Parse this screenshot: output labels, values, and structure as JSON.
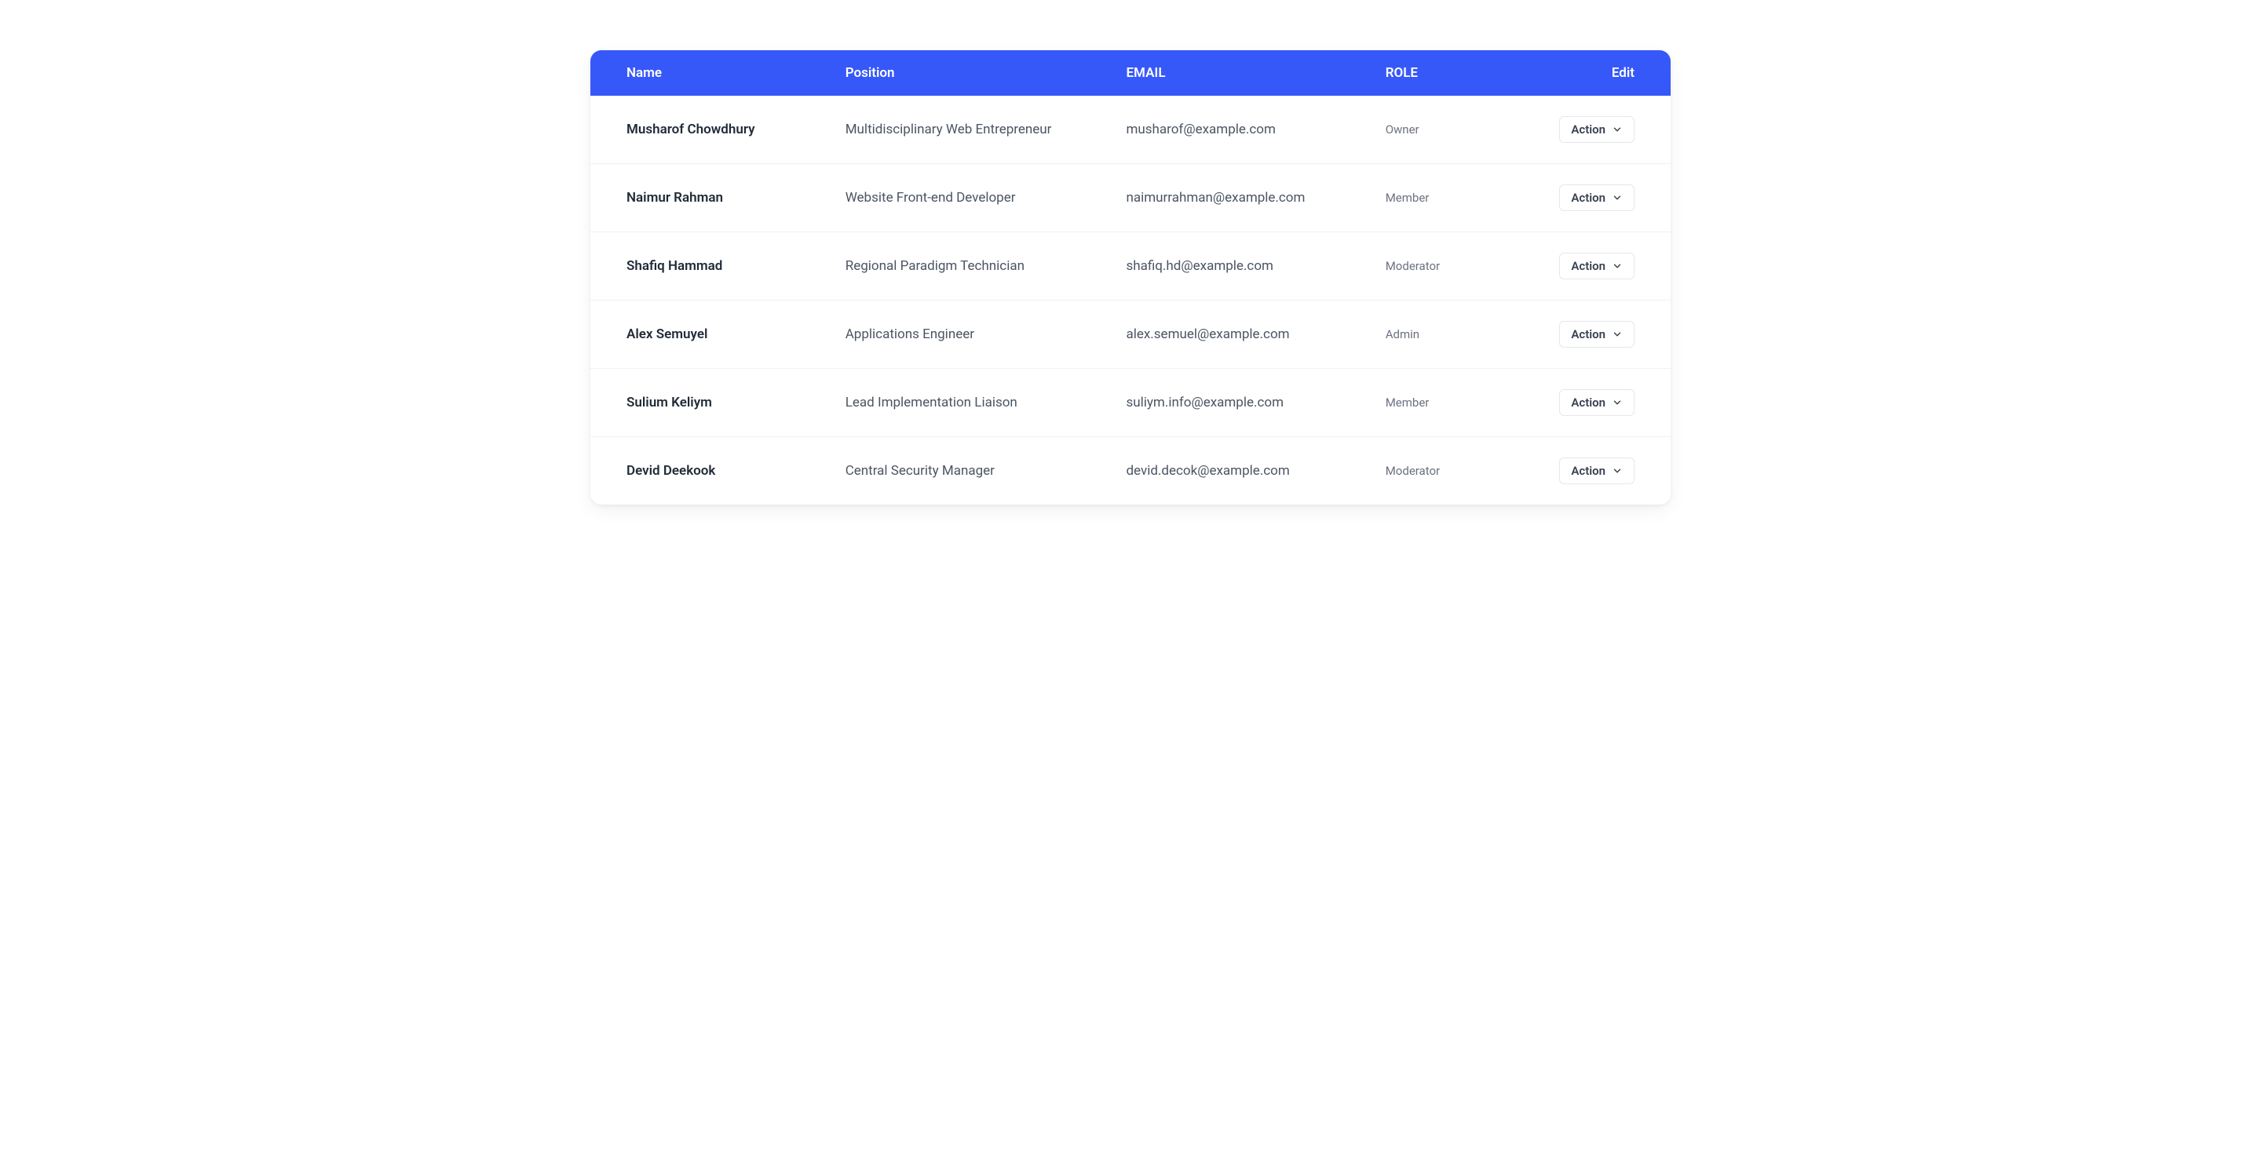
{
  "table": {
    "headers": {
      "name": "Name",
      "position": "Position",
      "email": "EMAIL",
      "role": "ROLE",
      "edit": "Edit"
    },
    "action_label": "Action",
    "rows": [
      {
        "name": "Musharof Chowdhury",
        "position": "Multidisciplinary Web Entrepreneur",
        "email": "musharof@example.com",
        "role": "Owner"
      },
      {
        "name": "Naimur Rahman",
        "position": "Website Front-end Developer",
        "email": "naimurrahman@example.com",
        "role": "Member"
      },
      {
        "name": "Shafiq Hammad",
        "position": "Regional Paradigm Technician",
        "email": "shafiq.hd@example.com",
        "role": "Moderator"
      },
      {
        "name": "Alex Semuyel",
        "position": "Applications Engineer",
        "email": "alex.semuel@example.com",
        "role": "Admin"
      },
      {
        "name": "Sulium Keliym",
        "position": "Lead Implementation Liaison",
        "email": "suliym.info@example.com",
        "role": "Member"
      },
      {
        "name": "Devid Deekook",
        "position": "Central Security Manager",
        "email": "devid.decok@example.com",
        "role": "Moderator"
      }
    ]
  }
}
